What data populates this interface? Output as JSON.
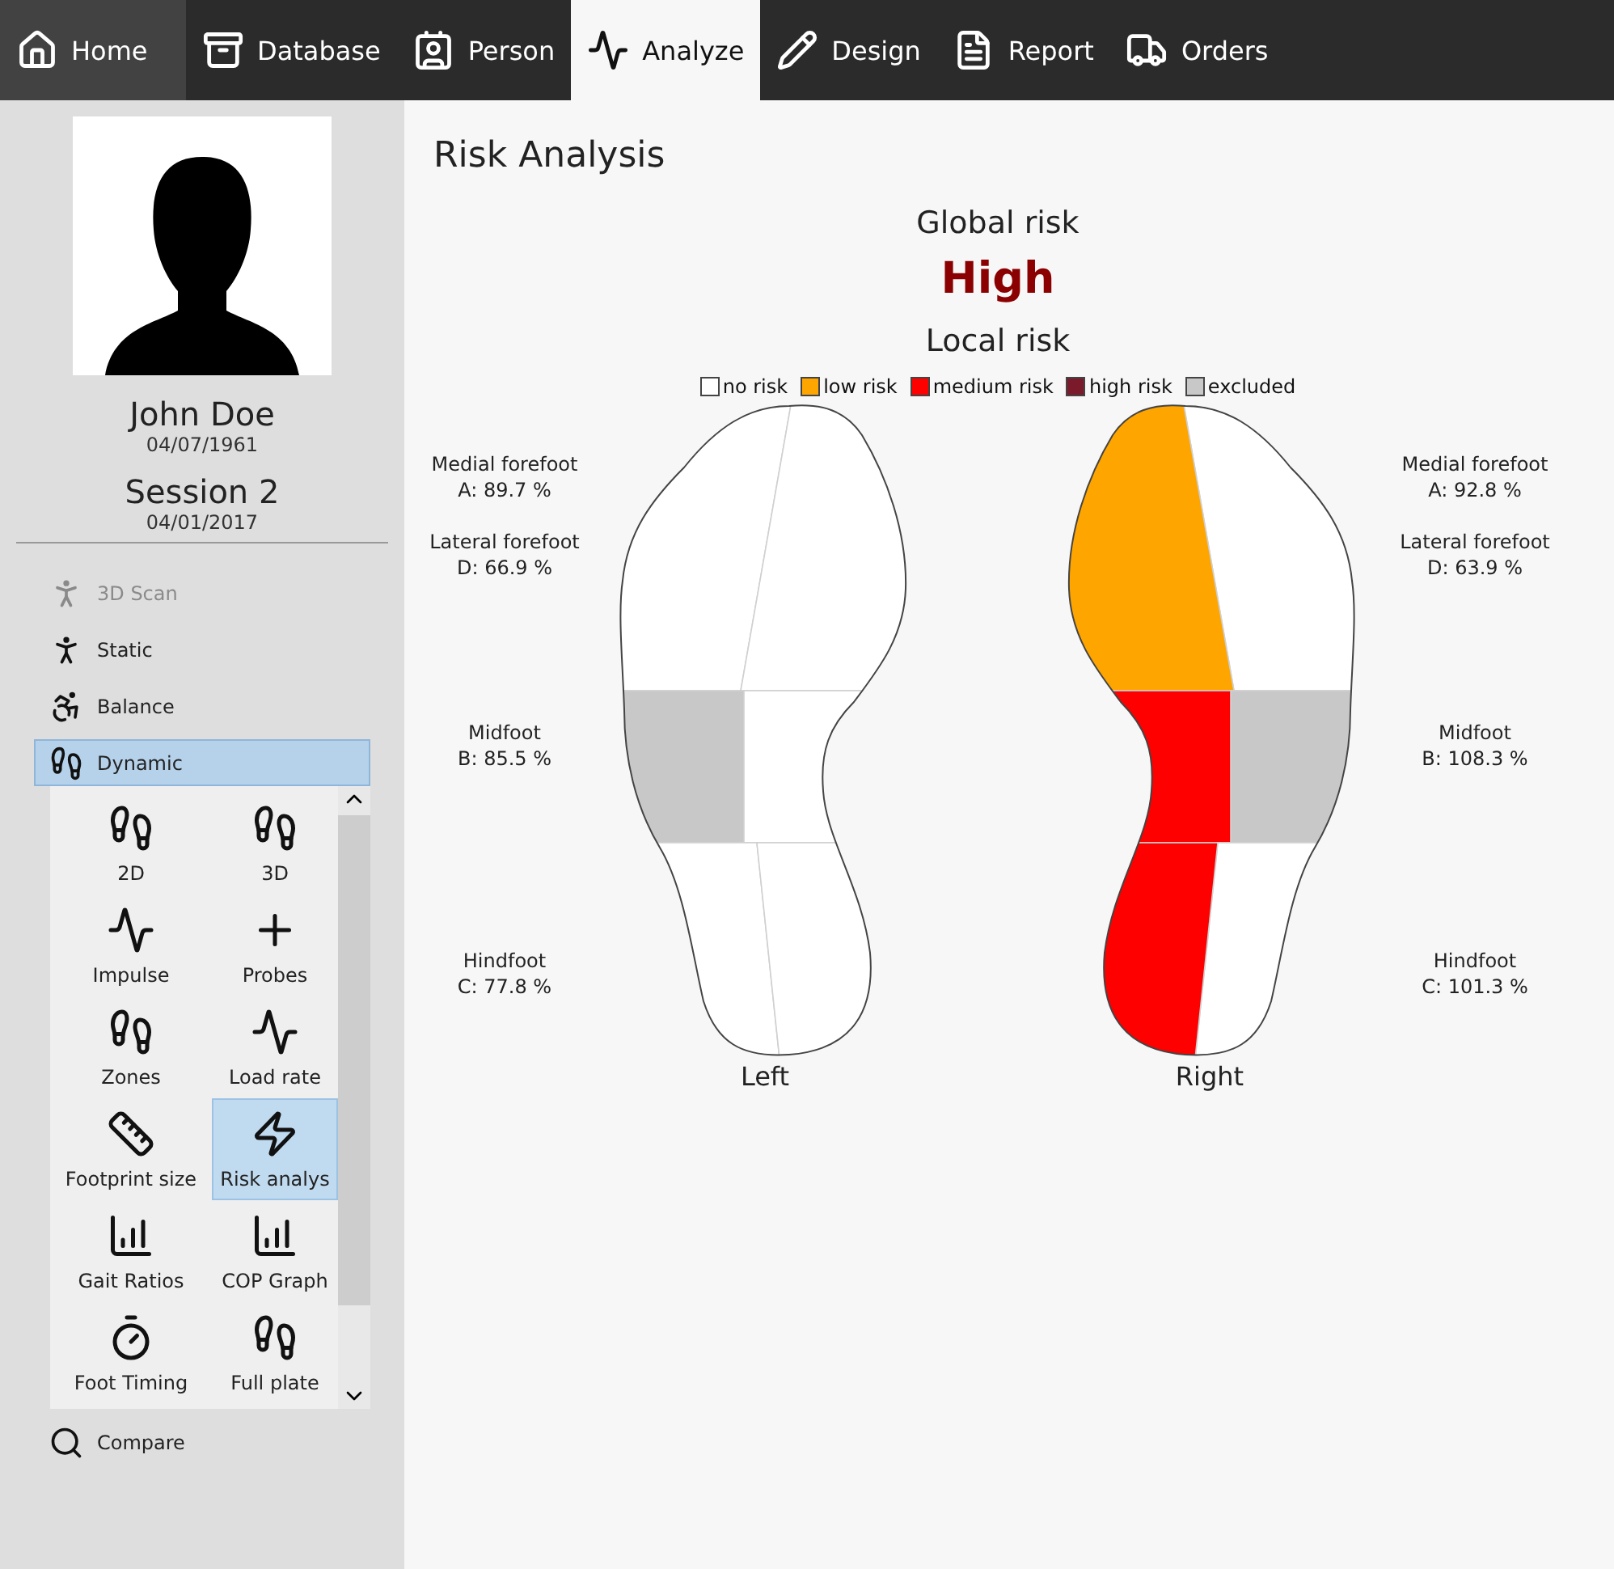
{
  "nav": [
    {
      "label": "Home",
      "selected": false,
      "hovered": true
    },
    {
      "label": "Database",
      "selected": false,
      "hovered": false
    },
    {
      "label": "Person",
      "selected": false,
      "hovered": false
    },
    {
      "label": "Analyze",
      "selected": true,
      "hovered": false
    },
    {
      "label": "Design",
      "selected": false,
      "hovered": false
    },
    {
      "label": "Report",
      "selected": false,
      "hovered": false
    },
    {
      "label": "Orders",
      "selected": false,
      "hovered": false
    }
  ],
  "patient": {
    "name": "John Doe",
    "birth_date": "04/07/1961",
    "session": "Session 2",
    "session_date": "04/01/2017"
  },
  "modules": [
    {
      "label": "3D Scan",
      "disabled": true,
      "selected": false
    },
    {
      "label": "Static",
      "disabled": false,
      "selected": false
    },
    {
      "label": "Balance",
      "disabled": false,
      "selected": false
    },
    {
      "label": "Dynamic",
      "disabled": false,
      "selected": true,
      "expanded": true,
      "tools": [
        {
          "label": "2D",
          "selected": false
        },
        {
          "label": "3D",
          "selected": false
        },
        {
          "label": "Impulse",
          "selected": false
        },
        {
          "label": "Probes",
          "selected": false
        },
        {
          "label": "Zones",
          "selected": false
        },
        {
          "label": "Load rate",
          "selected": false
        },
        {
          "label": "Footprint size",
          "selected": false
        },
        {
          "label": "Risk analys",
          "selected": true
        },
        {
          "label": "Gait Ratios",
          "selected": false
        },
        {
          "label": "COP Graph",
          "selected": false
        },
        {
          "label": "Foot Timing",
          "selected": false
        },
        {
          "label": "Full plate",
          "selected": false
        }
      ]
    },
    {
      "label": "Compare",
      "disabled": false,
      "selected": false
    }
  ],
  "page_title": "Risk Analysis",
  "global_risk": {
    "heading": "Global risk",
    "value": "High"
  },
  "local_risk": {
    "heading": "Local risk",
    "legend": [
      {
        "label": "no risk",
        "color": "#ffffff"
      },
      {
        "label": "low risk",
        "color": "#ffa500"
      },
      {
        "label": "medium risk",
        "color": "#ff0000"
      },
      {
        "label": "high risk",
        "color": "#7a1a2a"
      },
      {
        "label": "excluded",
        "color": "#c8c8c8"
      }
    ],
    "feet": [
      {
        "label": "Left",
        "kind": "left",
        "regions": [
          {
            "name": "Medial forefoot",
            "reading": "A: 89.7 %"
          },
          {
            "name": "Lateral forefoot",
            "reading": "D: 66.9 %"
          },
          {
            "name": "Midfoot",
            "reading": "B: 85.5 %"
          },
          {
            "name": "Hindfoot",
            "reading": "C: 77.8 %"
          }
        ],
        "zones": [
          {
            "kind": "lateralforefoot",
            "color": "#ffffff"
          },
          {
            "kind": "medialforefoot",
            "color": "#ffffff"
          },
          {
            "kind": "lateralmidfoot",
            "color": "#c8c8c8"
          },
          {
            "kind": "medialmidfoot",
            "color": "#ffffff"
          },
          {
            "kind": "lateralhindfoot",
            "color": "#ffffff"
          },
          {
            "kind": "medialhindfoot",
            "color": "#ffffff"
          }
        ]
      },
      {
        "label": "Right",
        "kind": "right",
        "regions": [
          {
            "name": "Medial forefoot",
            "reading": "A: 92.8 %"
          },
          {
            "name": "Lateral forefoot",
            "reading": "D: 63.9 %"
          },
          {
            "name": "Midfoot",
            "reading": "B: 108.3 %"
          },
          {
            "name": "Hindfoot",
            "reading": "C: 101.3 %"
          }
        ],
        "zones": [
          {
            "kind": "lateralforefoot",
            "color": "#ffffff"
          },
          {
            "kind": "medialforefoot",
            "color": "#ffa500"
          },
          {
            "kind": "lateralmidfoot",
            "color": "#c8c8c8"
          },
          {
            "kind": "medialmidfoot",
            "color": "#ff0000"
          },
          {
            "kind": "lateralhindfoot",
            "color": "#ffffff"
          },
          {
            "kind": "medialhindfoot",
            "color": "#ff0000"
          }
        ]
      }
    ]
  }
}
